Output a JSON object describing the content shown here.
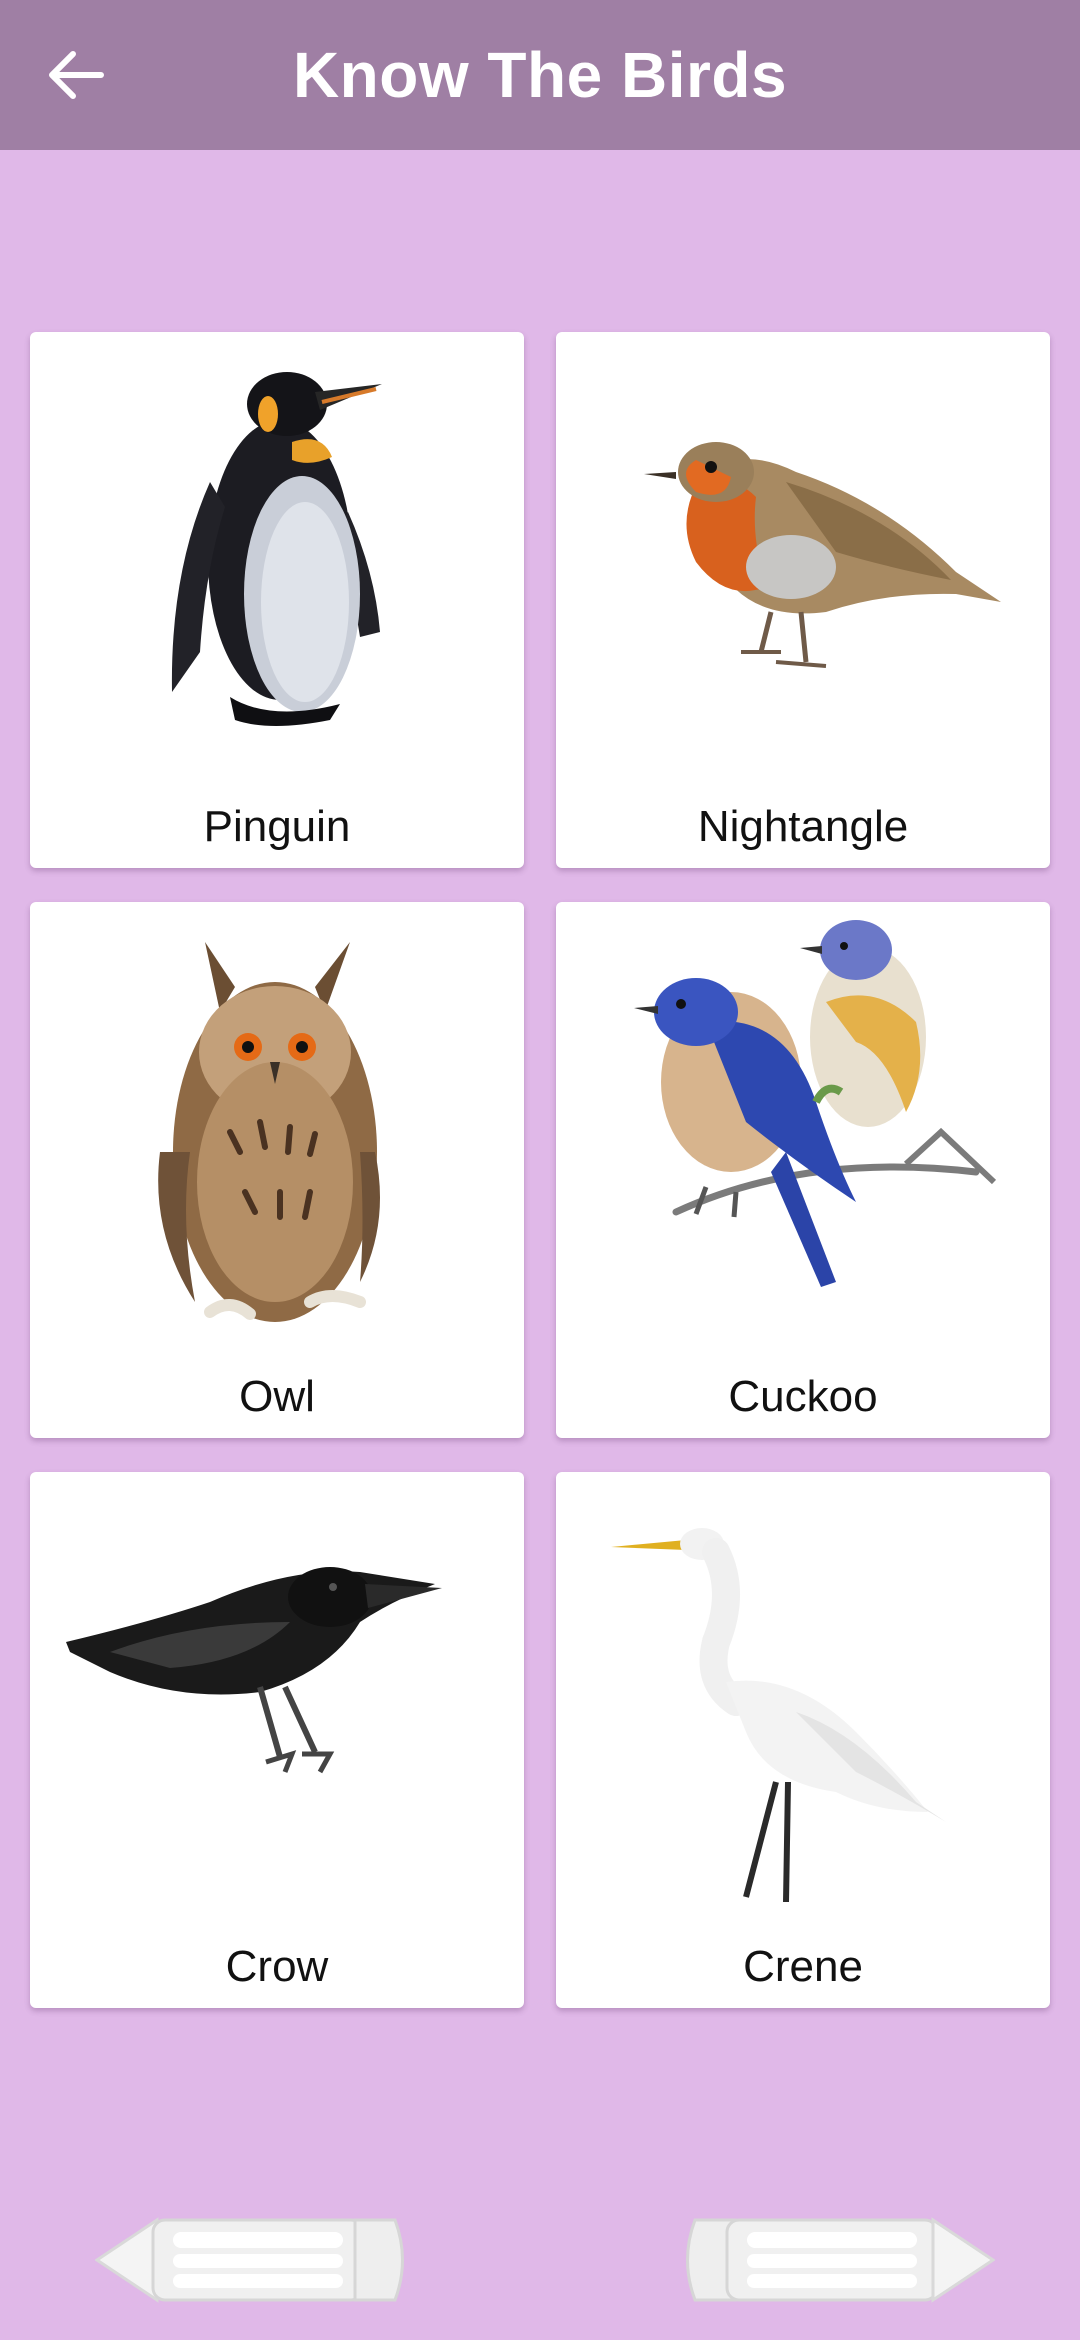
{
  "appbar": {
    "title": "Know The Birds",
    "back_icon": "arrow-left-icon"
  },
  "birds": [
    {
      "label": "Pinguin",
      "icon": "penguin-image"
    },
    {
      "label": "Nightangle",
      "icon": "robin-image"
    },
    {
      "label": "Owl",
      "icon": "owl-image"
    },
    {
      "label": "Cuckoo",
      "icon": "bluebird-image"
    },
    {
      "label": "Crow",
      "icon": "crow-image"
    },
    {
      "label": "Crene",
      "icon": "egret-image"
    }
  ],
  "navigation": {
    "previous_icon": "pencil-arrow-left-icon",
    "next_icon": "pencil-arrow-right-icon"
  },
  "colors": {
    "appbar": "#9f7fa4",
    "background": "#e0b8e8",
    "card": "#ffffff"
  }
}
